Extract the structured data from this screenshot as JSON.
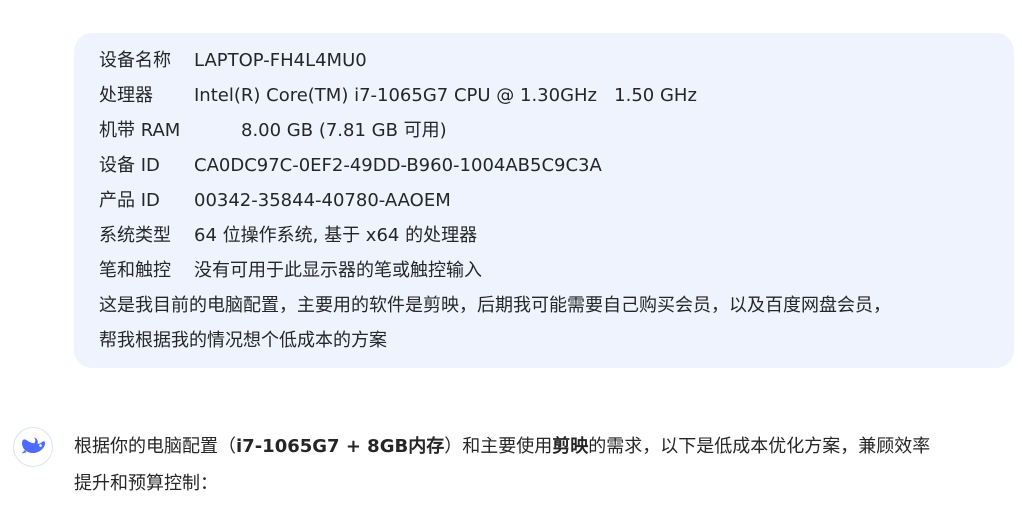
{
  "user_message": {
    "specs": [
      {
        "label": "设备名称",
        "value": "LAPTOP-FH4L4MU0"
      },
      {
        "label": "处理器",
        "value": "Intel(R) Core(TM) i7-1065G7 CPU @ 1.30GHz   1.50 GHz"
      },
      {
        "label": "机带 RAM",
        "value": "8.00 GB (7.81 GB 可用)"
      },
      {
        "label": "设备 ID",
        "value": "CA0DC97C-0EF2-49DD-B960-1004AB5C9C3A"
      },
      {
        "label": "产品 ID",
        "value": "00342-35844-40780-AAOEM"
      },
      {
        "label": "系统类型",
        "value": "64 位操作系统, 基于 x64 的处理器"
      },
      {
        "label": "笔和触控",
        "value": "没有可用于此显示器的笔或触控输入"
      }
    ],
    "text_line_1": "这是我目前的电脑配置，主要用的软件是剪映，后期我可能需要自己购买会员，以及百度网盘会员，",
    "text_line_2": "帮我根据我的情况想个低成本的方案"
  },
  "assistant_message": {
    "avatar_icon": "whale-logo-icon",
    "accent_color": "#4d6bfe",
    "part_1": "根据你的电脑配置（",
    "bold_1": "i7-1065G7 + 8GB内存",
    "part_2": "）和主要使用",
    "bold_2": "剪映",
    "part_3": "的需求，以下是低成本优化方案，兼顾效率",
    "line_2": "提升和预算控制："
  }
}
